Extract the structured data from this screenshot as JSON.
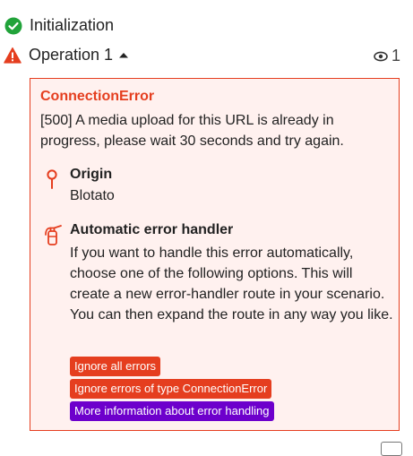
{
  "steps": [
    {
      "title": "Initialization",
      "status": "success"
    },
    {
      "title": "Operation 1",
      "status": "error",
      "operations_count": "1"
    }
  ],
  "error": {
    "type": "ConnectionError",
    "message": "[500] A media upload for this URL is already in progress, please wait 30 seconds and try again.",
    "origin": {
      "title": "Origin",
      "value": "Blotato"
    },
    "handler": {
      "title": "Automatic error handler",
      "description": "If you want to handle this error automatically, choose one of the following options. This will create a new error-handler route in your scenario. You can then expand the route in any way you like.",
      "actions": [
        {
          "label": "Ignore all errors",
          "color": "#e53e1f"
        },
        {
          "label": "Ignore errors of type ConnectionError",
          "color": "#e53e1f"
        },
        {
          "label": "More information about error handling",
          "color": "#6d00cc"
        }
      ]
    }
  },
  "colors": {
    "success": "#21a33a",
    "error": "#e53e1f",
    "error_bg": "#fff1ef",
    "info": "#6d00cc"
  },
  "icons": [
    "check-circle-icon",
    "warning-triangle-icon",
    "caret-up-icon",
    "eye-icon",
    "pin-icon",
    "fire-extinguisher-icon"
  ]
}
